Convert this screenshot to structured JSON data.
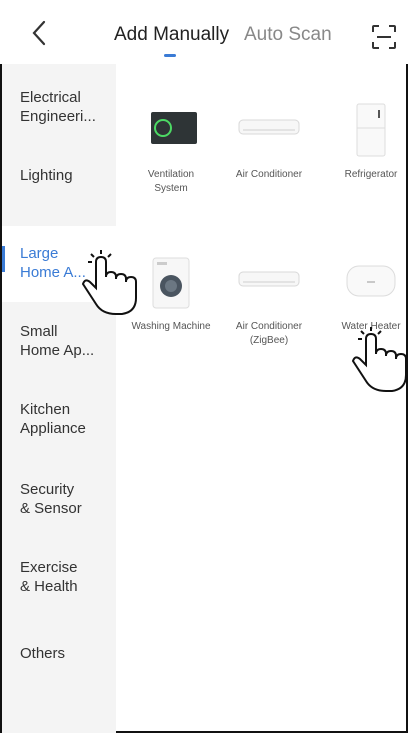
{
  "header": {
    "tabs": [
      {
        "label": "Add Manually",
        "active": true
      },
      {
        "label": "Auto Scan",
        "active": false
      }
    ]
  },
  "sidebar": {
    "items": [
      {
        "label": "Electrical\nEngineeri..."
      },
      {
        "label": "Lighting"
      },
      {
        "label": "Large\nHome A..."
      },
      {
        "label": "Small\nHome Ap..."
      },
      {
        "label": "Kitchen\nAppliance"
      },
      {
        "label": "Security\n& Sensor"
      },
      {
        "label": "Exercise\n& Health"
      },
      {
        "label": "Others"
      }
    ],
    "active_index": 2
  },
  "devices": [
    {
      "label": "Ventilation\nSystem",
      "icon": "ventilation-icon"
    },
    {
      "label": "Air Conditioner",
      "icon": "air-conditioner-icon"
    },
    {
      "label": "Refrigerator",
      "icon": "refrigerator-icon"
    },
    {
      "label": "Washing Machine",
      "icon": "washing-machine-icon"
    },
    {
      "label": "Air Conditioner\n(ZigBee)",
      "icon": "air-conditioner-icon"
    },
    {
      "label": "Water Heater",
      "icon": "water-heater-icon"
    }
  ],
  "colors": {
    "accent": "#3a7bd5",
    "sidebar_bg": "#f4f4f4"
  }
}
